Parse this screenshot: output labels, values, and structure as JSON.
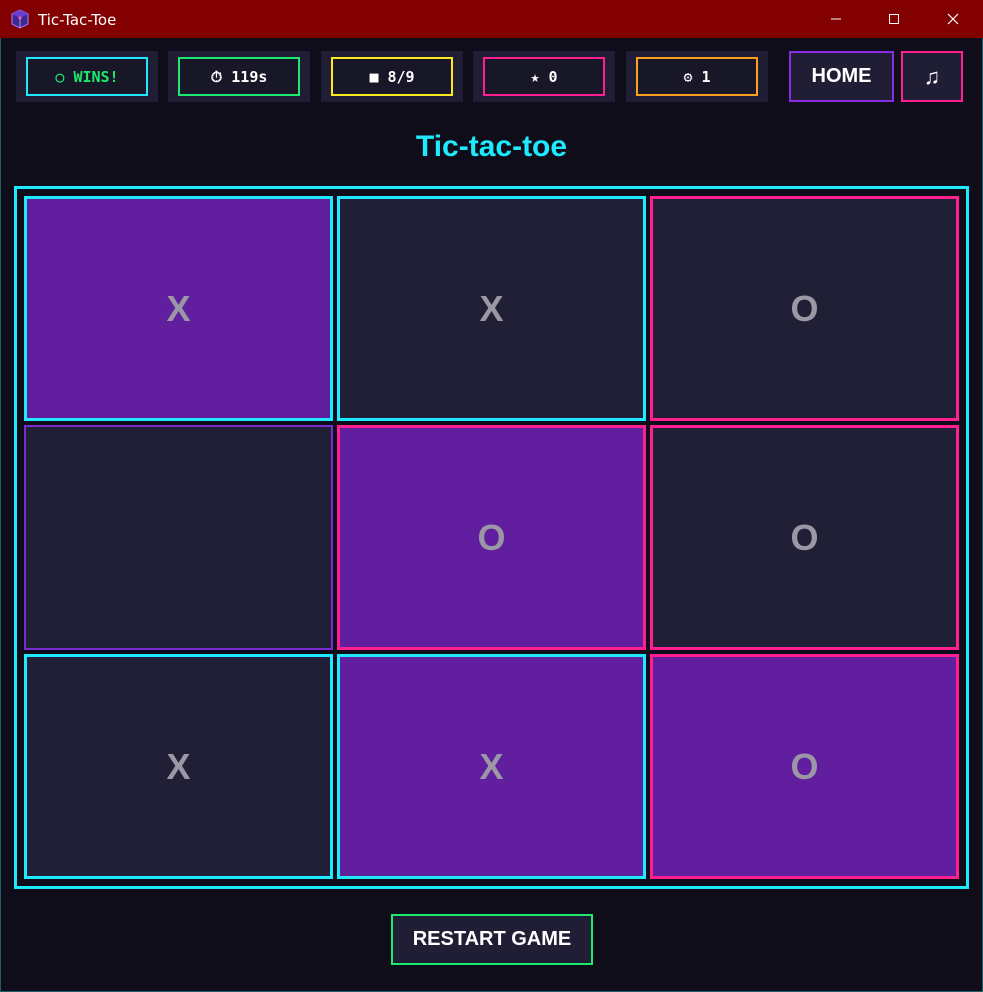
{
  "window": {
    "title": "Tic-Tac-Toe",
    "icon": "cube-icon",
    "controls": [
      "minimize-icon",
      "maximize-icon",
      "close-icon"
    ]
  },
  "stats": [
    {
      "glyph": "○",
      "text": "WINS!",
      "icon": "circle-icon",
      "color": "#1bea6e",
      "border": "#1ee9ff"
    },
    {
      "glyph": "⏱",
      "text": "119s",
      "icon": "stopwatch-icon",
      "color": "#ffffff",
      "border": "#1bea6e"
    },
    {
      "glyph": "■",
      "text": "8/9",
      "icon": "square-icon",
      "color": "#ffffff",
      "border": "#ffe81f"
    },
    {
      "glyph": "★",
      "text": "0",
      "icon": "star-icon",
      "color": "#ffffff",
      "border": "#ff1f8f"
    },
    {
      "glyph": "⚙",
      "text": "1",
      "icon": "gear-icon",
      "color": "#ffffff",
      "border": "#ff9d1f"
    }
  ],
  "nav": {
    "home_label": "HOME",
    "music_glyph": "♫"
  },
  "game": {
    "title": "Tic-tac-toe",
    "cells": [
      "X",
      "X",
      "O",
      "",
      "O",
      "O",
      "X",
      "X",
      "O"
    ]
  },
  "restart_label": "RESTART GAME",
  "colors": {
    "accent_cyan": "#1ee9ff",
    "accent_pink": "#ff1f8f",
    "accent_green": "#1bea6e",
    "accent_yellow": "#ffe81f",
    "accent_orange": "#ff9d1f",
    "accent_purple": "#8a2be2",
    "titlebar": "#820000",
    "cell_dark": "#201f36",
    "cell_purple": "#611e9e",
    "mark": "#9b98a6"
  }
}
